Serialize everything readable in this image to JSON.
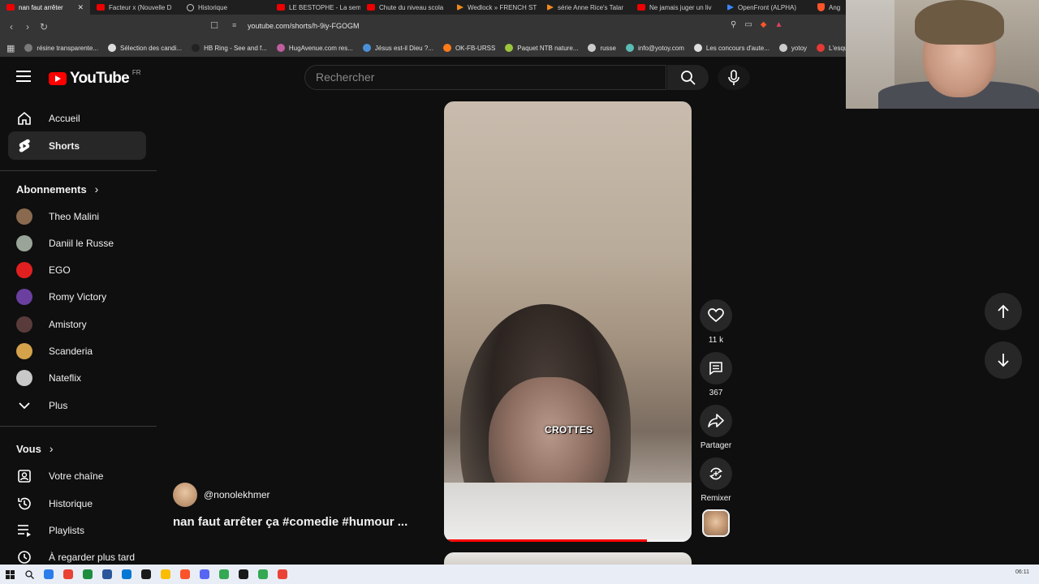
{
  "browser": {
    "tabs": [
      {
        "label": "nan faut arrêter",
        "icon": "youtube-icon",
        "active": true
      },
      {
        "label": "Facteur x (Nouvelle D",
        "icon": "youtube-icon"
      },
      {
        "label": "Historique",
        "icon": "history-icon"
      },
      {
        "label": "LE BESTOPHE - La sem",
        "icon": "youtube-icon"
      },
      {
        "label": "Chute du niveau scola",
        "icon": "youtube-icon"
      },
      {
        "label": "Wedlock » FRENCH ST",
        "icon": "play-orange-icon"
      },
      {
        "label": "série Anne Rice's Talar",
        "icon": "play-orange-icon"
      },
      {
        "label": "Ne jamais juger un liv",
        "icon": "youtube-icon"
      },
      {
        "label": "OpenFront (ALPHA)",
        "icon": "play-blue-icon"
      },
      {
        "label": "Ang",
        "icon": "brave-icon"
      }
    ],
    "url": "youtube.com/shorts/h-9iy-FGOGM",
    "bookmarks": [
      "résine transparente...",
      "Sélection des candi...",
      "HB Ring - See and f...",
      "HugAvenue.com res...",
      "Jésus est-il Dieu ?...",
      "OK-FB-URSS",
      "Paquet NTB nature...",
      "russe",
      "info@yotoy.com",
      "Les concours d'aute...",
      "yotoy",
      "L'esqu"
    ]
  },
  "header": {
    "logo_text": "YouTube",
    "region": "FR",
    "search_placeholder": "Rechercher"
  },
  "sidebar": {
    "main": [
      {
        "label": "Accueil",
        "icon": "home-icon"
      },
      {
        "label": "Shorts",
        "icon": "shorts-icon",
        "selected": true
      }
    ],
    "subscriptions_title": "Abonnements",
    "subscriptions": [
      {
        "label": "Theo Malini",
        "color": "#8a6a4e"
      },
      {
        "label": "Daniil le Russe",
        "color": "#9aa59a"
      },
      {
        "label": "EGO",
        "color": "#e02020"
      },
      {
        "label": "Romy Victory",
        "color": "#6b3fa0"
      },
      {
        "label": "Amistory",
        "color": "#5a3b3b"
      },
      {
        "label": "Scanderia",
        "color": "#d4a24a"
      },
      {
        "label": "Nateflix",
        "color": "#c8c8c8"
      }
    ],
    "more_label": "Plus",
    "you_title": "Vous",
    "you_items": [
      {
        "label": "Votre chaîne",
        "icon": "channel-icon"
      },
      {
        "label": "Historique",
        "icon": "history-icon"
      },
      {
        "label": "Playlists",
        "icon": "playlists-icon"
      },
      {
        "label": "À regarder plus tard",
        "icon": "watch-later-icon"
      }
    ]
  },
  "short": {
    "caption": "CROTTES",
    "progress": 0.82,
    "channel": "@nonolekhmer",
    "title": "nan faut arrêter ça #comedie #humour ...",
    "likes": "11 k",
    "comments": "367",
    "share_label": "Partager",
    "remix_label": "Remixer"
  },
  "taskbar": {
    "clock": "06:11"
  }
}
